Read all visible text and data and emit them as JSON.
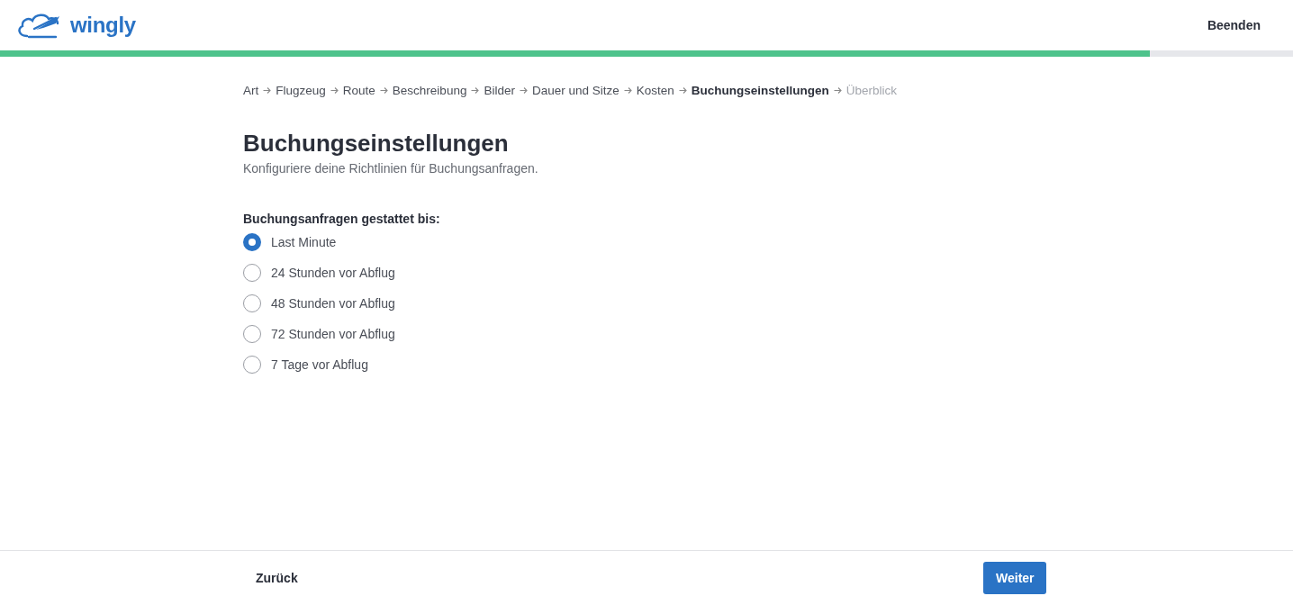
{
  "header": {
    "logo": "wingly",
    "exit": "Beenden"
  },
  "progress": {
    "level": 0.889
  },
  "breadcrumb": [
    {
      "label": "Art",
      "selected": false,
      "disabled": false
    },
    {
      "label": "Flugzeug",
      "selected": false,
      "disabled": false
    },
    {
      "label": "Route",
      "selected": false,
      "disabled": false
    },
    {
      "label": "Beschreibung",
      "selected": false,
      "disabled": false
    },
    {
      "label": "Bilder",
      "selected": false,
      "disabled": false
    },
    {
      "label": "Dauer und Sitze",
      "selected": false,
      "disabled": false
    },
    {
      "label": "Kosten",
      "selected": false,
      "disabled": false
    },
    {
      "label": "Buchungseinstellungen",
      "selected": true,
      "disabled": false
    },
    {
      "label": "Überblick",
      "selected": false,
      "disabled": true
    }
  ],
  "title": "Buchungseinstellungen",
  "subtitle": "Konfiguriere deine Richtlinien für Buchungsanfragen.",
  "question": "Buchungsanfragen gestattet bis:",
  "options": [
    {
      "label": "Last Minute",
      "selected": true
    },
    {
      "label": "24 Stunden vor Abflug",
      "selected": false
    },
    {
      "label": "48 Stunden vor Abflug",
      "selected": false
    },
    {
      "label": "72 Stunden vor Abflug",
      "selected": false
    },
    {
      "label": "7 Tage vor Abflug",
      "selected": false
    }
  ],
  "footer": {
    "back": "Zurück",
    "next": "Weiter"
  }
}
